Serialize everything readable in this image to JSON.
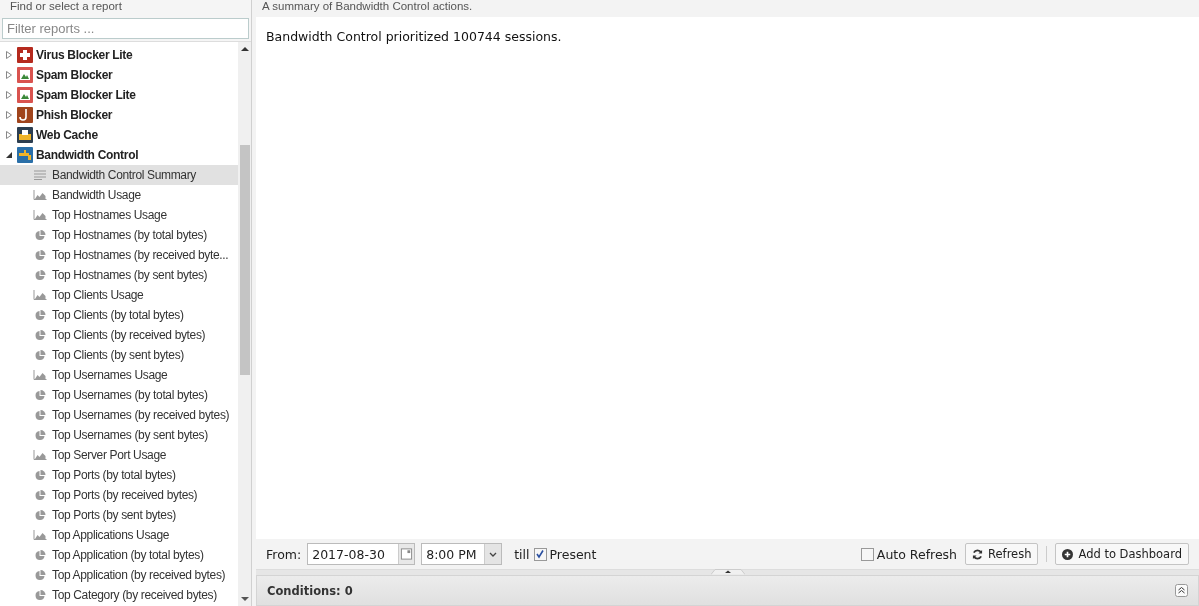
{
  "sidebar": {
    "title": "Find or select a report",
    "filter": {
      "placeholder": "Filter reports ..."
    },
    "apps": [
      {
        "name": "Virus Blocker Lite",
        "expanded": false
      },
      {
        "name": "Spam Blocker",
        "expanded": false
      },
      {
        "name": "Spam Blocker Lite",
        "expanded": false
      },
      {
        "name": "Phish Blocker",
        "expanded": false
      },
      {
        "name": "Web Cache",
        "expanded": false
      },
      {
        "name": "Bandwidth Control",
        "expanded": true,
        "children": [
          {
            "name": "Bandwidth Control Summary",
            "kind": "text",
            "selected": true
          },
          {
            "name": "Bandwidth Usage",
            "kind": "area",
            "selected": false
          },
          {
            "name": "Top Hostnames Usage",
            "kind": "area",
            "selected": false
          },
          {
            "name": "Top Hostnames (by total bytes)",
            "kind": "pie",
            "selected": false
          },
          {
            "name": "Top Hostnames (by received byte...",
            "kind": "pie",
            "selected": false
          },
          {
            "name": "Top Hostnames (by sent bytes)",
            "kind": "pie",
            "selected": false
          },
          {
            "name": "Top Clients Usage",
            "kind": "area",
            "selected": false
          },
          {
            "name": "Top Clients (by total bytes)",
            "kind": "pie",
            "selected": false
          },
          {
            "name": "Top Clients (by received bytes)",
            "kind": "pie",
            "selected": false
          },
          {
            "name": "Top Clients (by sent bytes)",
            "kind": "pie",
            "selected": false
          },
          {
            "name": "Top Usernames Usage",
            "kind": "area",
            "selected": false
          },
          {
            "name": "Top Usernames (by total bytes)",
            "kind": "pie",
            "selected": false
          },
          {
            "name": "Top Usernames (by received bytes)",
            "kind": "pie",
            "selected": false
          },
          {
            "name": "Top Usernames (by sent bytes)",
            "kind": "pie",
            "selected": false
          },
          {
            "name": "Top Server Port Usage",
            "kind": "area",
            "selected": false
          },
          {
            "name": "Top Ports (by total bytes)",
            "kind": "pie",
            "selected": false
          },
          {
            "name": "Top Ports (by received bytes)",
            "kind": "pie",
            "selected": false
          },
          {
            "name": "Top Ports (by sent bytes)",
            "kind": "pie",
            "selected": false
          },
          {
            "name": "Top Applications Usage",
            "kind": "area",
            "selected": false
          },
          {
            "name": "Top Application (by total bytes)",
            "kind": "pie",
            "selected": false
          },
          {
            "name": "Top Application (by received bytes)",
            "kind": "pie",
            "selected": false
          },
          {
            "name": "Top Category (by received bytes)",
            "kind": "pie",
            "selected": false
          }
        ]
      }
    ]
  },
  "report": {
    "description": "A summary of Bandwidth Control actions.",
    "text": "Bandwidth Control prioritized 100744 sessions."
  },
  "toolbar": {
    "from_label": "From:",
    "date": "2017-08-30",
    "time": "8:00 PM",
    "till_label": "till",
    "present": {
      "label": "Present",
      "checked": true
    },
    "auto_refresh": {
      "label": "Auto Refresh",
      "checked": false
    },
    "refresh_button": "Refresh",
    "dashboard_button": "Add to Dashboard"
  },
  "conditions": {
    "label": "Conditions: 0"
  }
}
